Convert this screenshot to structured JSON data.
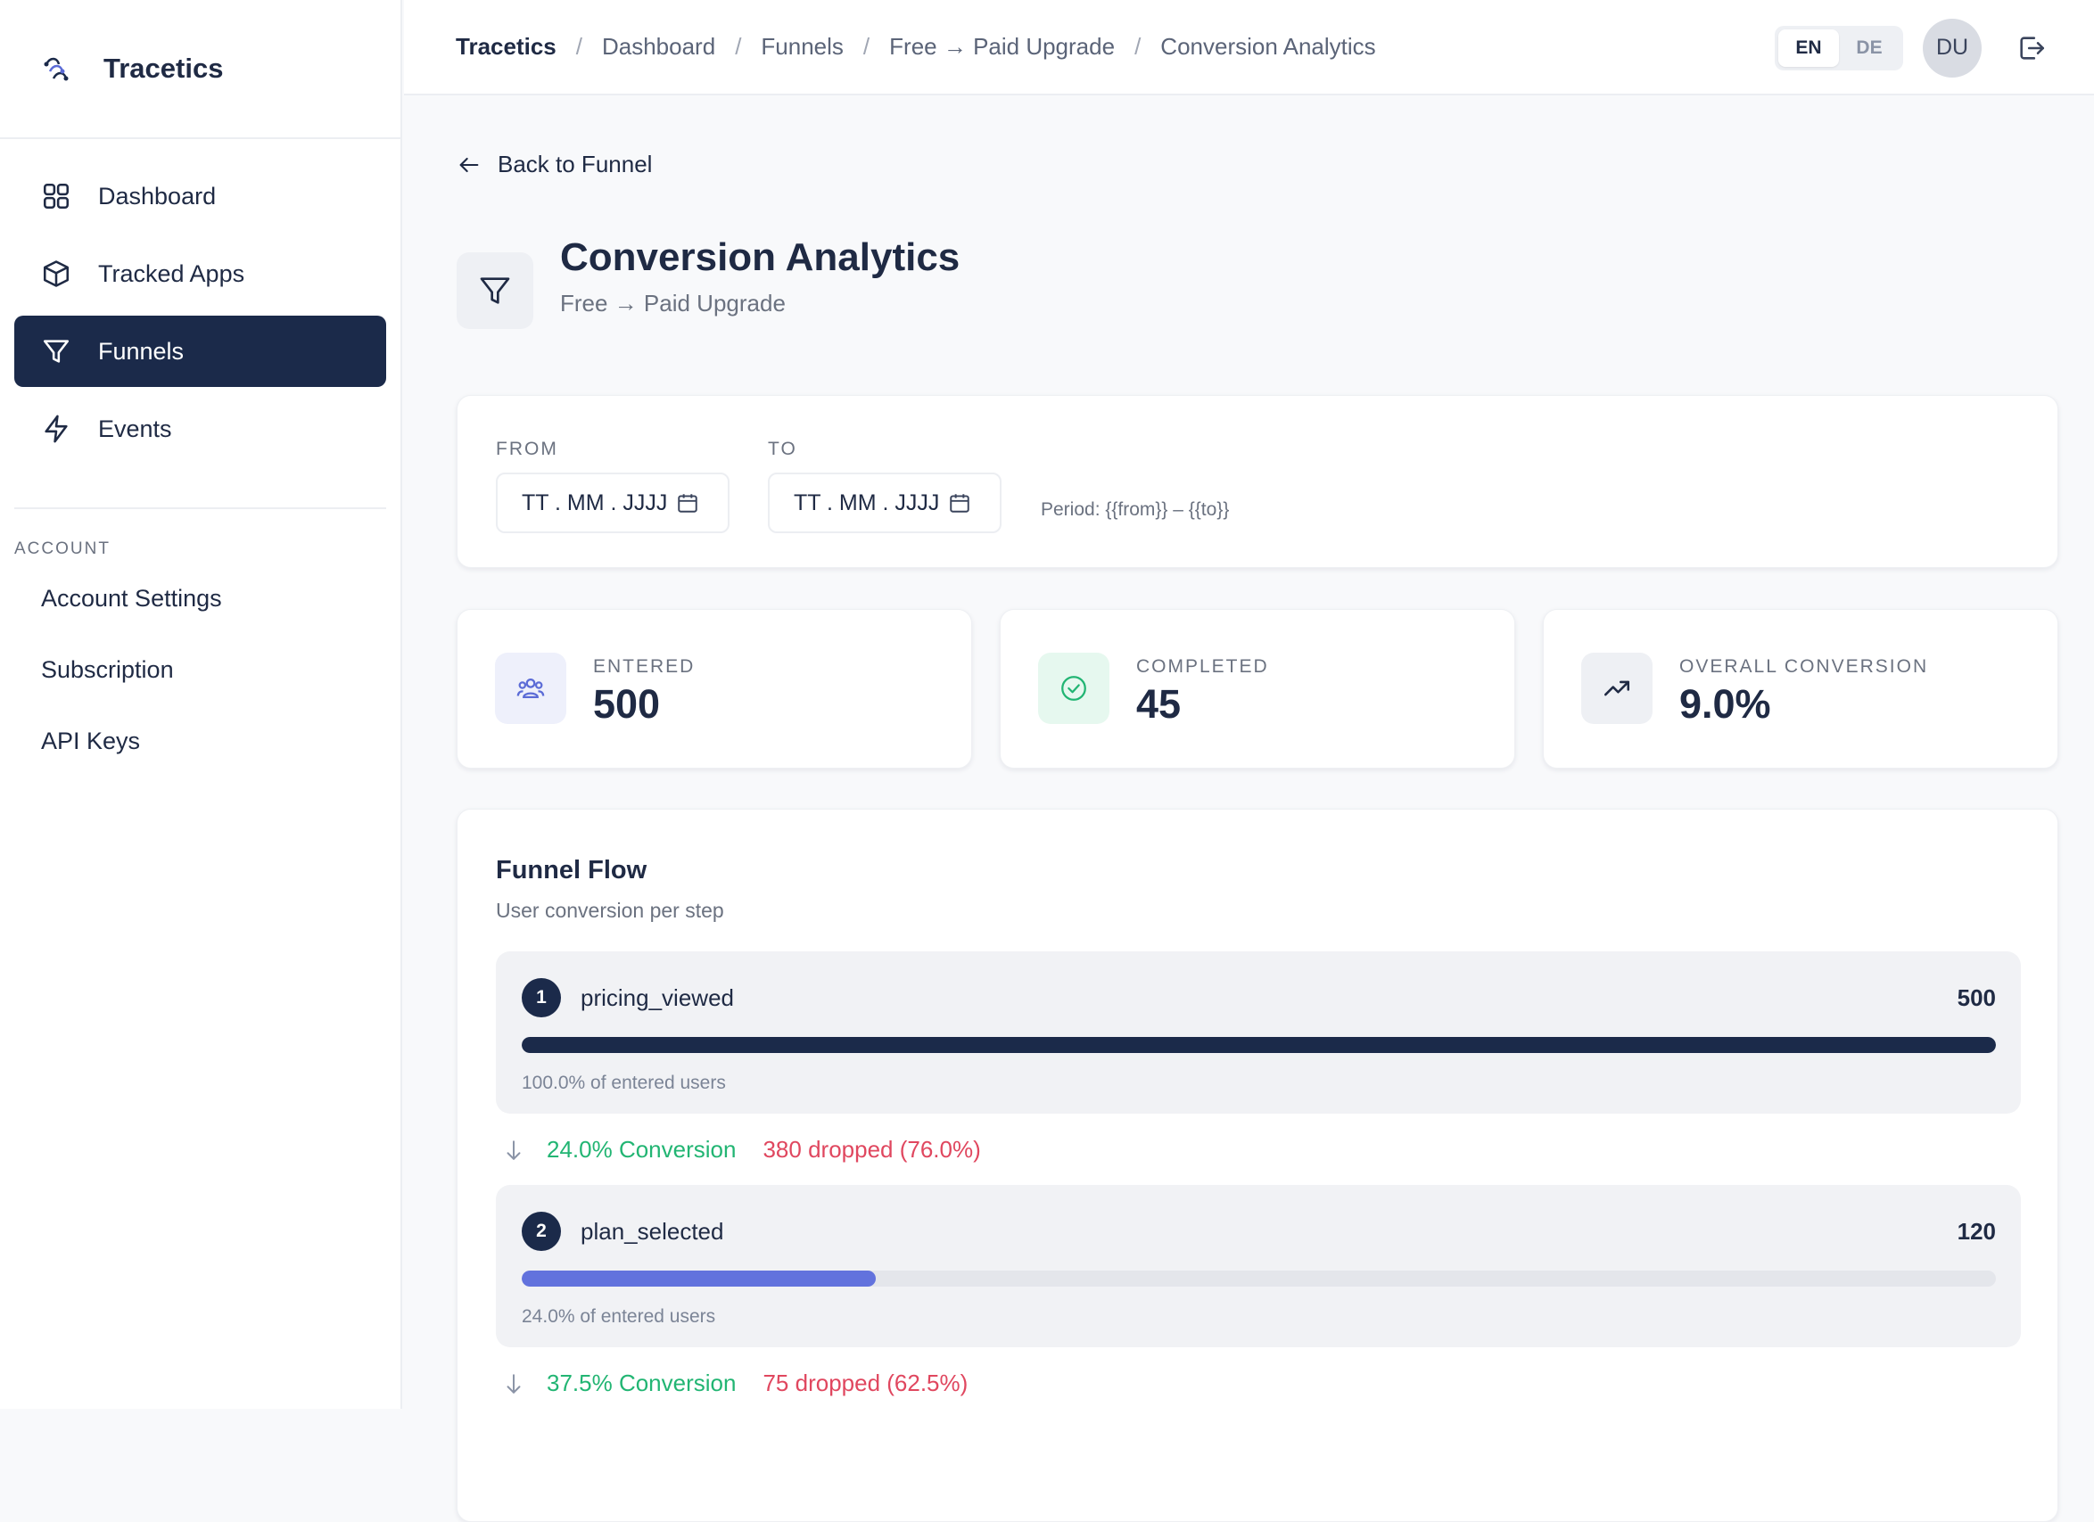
{
  "app": {
    "name": "Tracetics"
  },
  "sidebar": {
    "items": [
      {
        "label": "Dashboard",
        "icon": "grid-icon",
        "active": false
      },
      {
        "label": "Tracked Apps",
        "icon": "box-icon",
        "active": false
      },
      {
        "label": "Funnels",
        "icon": "funnel-icon",
        "active": true
      },
      {
        "label": "Events",
        "icon": "bolt-icon",
        "active": false
      }
    ],
    "account_label": "ACCOUNT",
    "account_items": [
      {
        "label": "Account Settings"
      },
      {
        "label": "Subscription"
      },
      {
        "label": "API Keys"
      }
    ]
  },
  "breadcrumb": [
    "Tracetics",
    "Dashboard",
    "Funnels",
    "Free → Paid Upgrade",
    "Conversion Analytics"
  ],
  "language": {
    "options": [
      "EN",
      "DE"
    ],
    "selected": "EN"
  },
  "user": {
    "initials": "DU"
  },
  "page": {
    "back_label": "Back to Funnel",
    "title": "Conversion Analytics",
    "subtitle": "Free → Paid Upgrade"
  },
  "filters": {
    "from_label": "FROM",
    "to_label": "TO",
    "from_placeholder": "TT . MM . JJJJ",
    "to_placeholder": "TT . MM . JJJJ",
    "period_text": "Period: {{from}} – {{to}}"
  },
  "stats": [
    {
      "label": "ENTERED",
      "value": "500",
      "icon": "users-icon",
      "tint": "#eef0fb",
      "color": "#5b6bd6"
    },
    {
      "label": "COMPLETED",
      "value": "45",
      "icon": "check-circle-icon",
      "tint": "#e6f8ef",
      "color": "#22b573"
    },
    {
      "label": "OVERALL CONVERSION",
      "value": "9.0%",
      "icon": "trending-up-icon",
      "tint": "#eef0f4",
      "color": "#1f2a44"
    }
  ],
  "flow": {
    "title": "Funnel Flow",
    "subtitle": "User conversion per step",
    "steps": [
      {
        "num": "1",
        "name": "pricing_viewed",
        "count": "500",
        "fraction": 1.0,
        "pct_text": "100.0% of entered users",
        "bar_color": "#1b2a4a"
      },
      {
        "num": "2",
        "name": "plan_selected",
        "count": "120",
        "fraction": 0.24,
        "pct_text": "24.0% of entered users",
        "bar_color": "#6272dd"
      }
    ],
    "transitions": [
      {
        "conversion": "24.0% Conversion",
        "dropped": "380 dropped (76.0%)"
      },
      {
        "conversion": "37.5% Conversion",
        "dropped": "75 dropped (62.5%)"
      }
    ]
  },
  "colors": {
    "primary": "#1b2a4a",
    "accent": "#6272dd",
    "success": "#22b573",
    "danger": "#e0475f"
  }
}
